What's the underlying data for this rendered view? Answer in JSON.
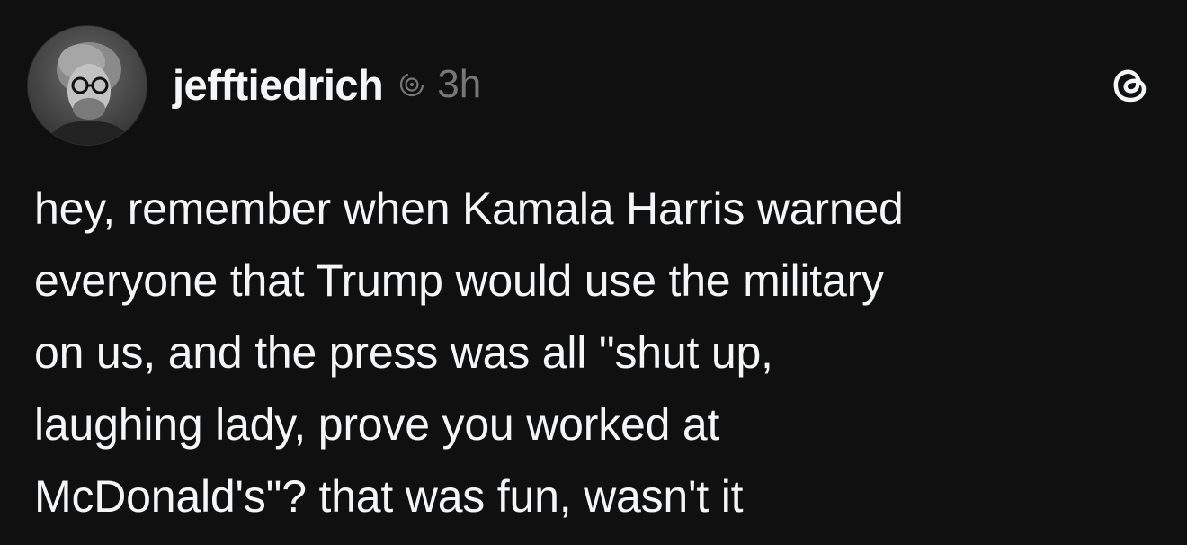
{
  "post": {
    "author": {
      "username": "jefftiedrich",
      "avatar_icon": "profile-photo"
    },
    "activity_icon": "activity-status-icon",
    "timestamp": "3h",
    "app_icon": "threads-logo-icon",
    "text_lines": [
      "hey, remember when Kamala Harris warned",
      "everyone that Trump would use the military",
      "on us, and the press was all \"shut up,",
      "laughing lady, prove you worked at",
      "McDonald's\"? that was fun, wasn't it"
    ]
  }
}
